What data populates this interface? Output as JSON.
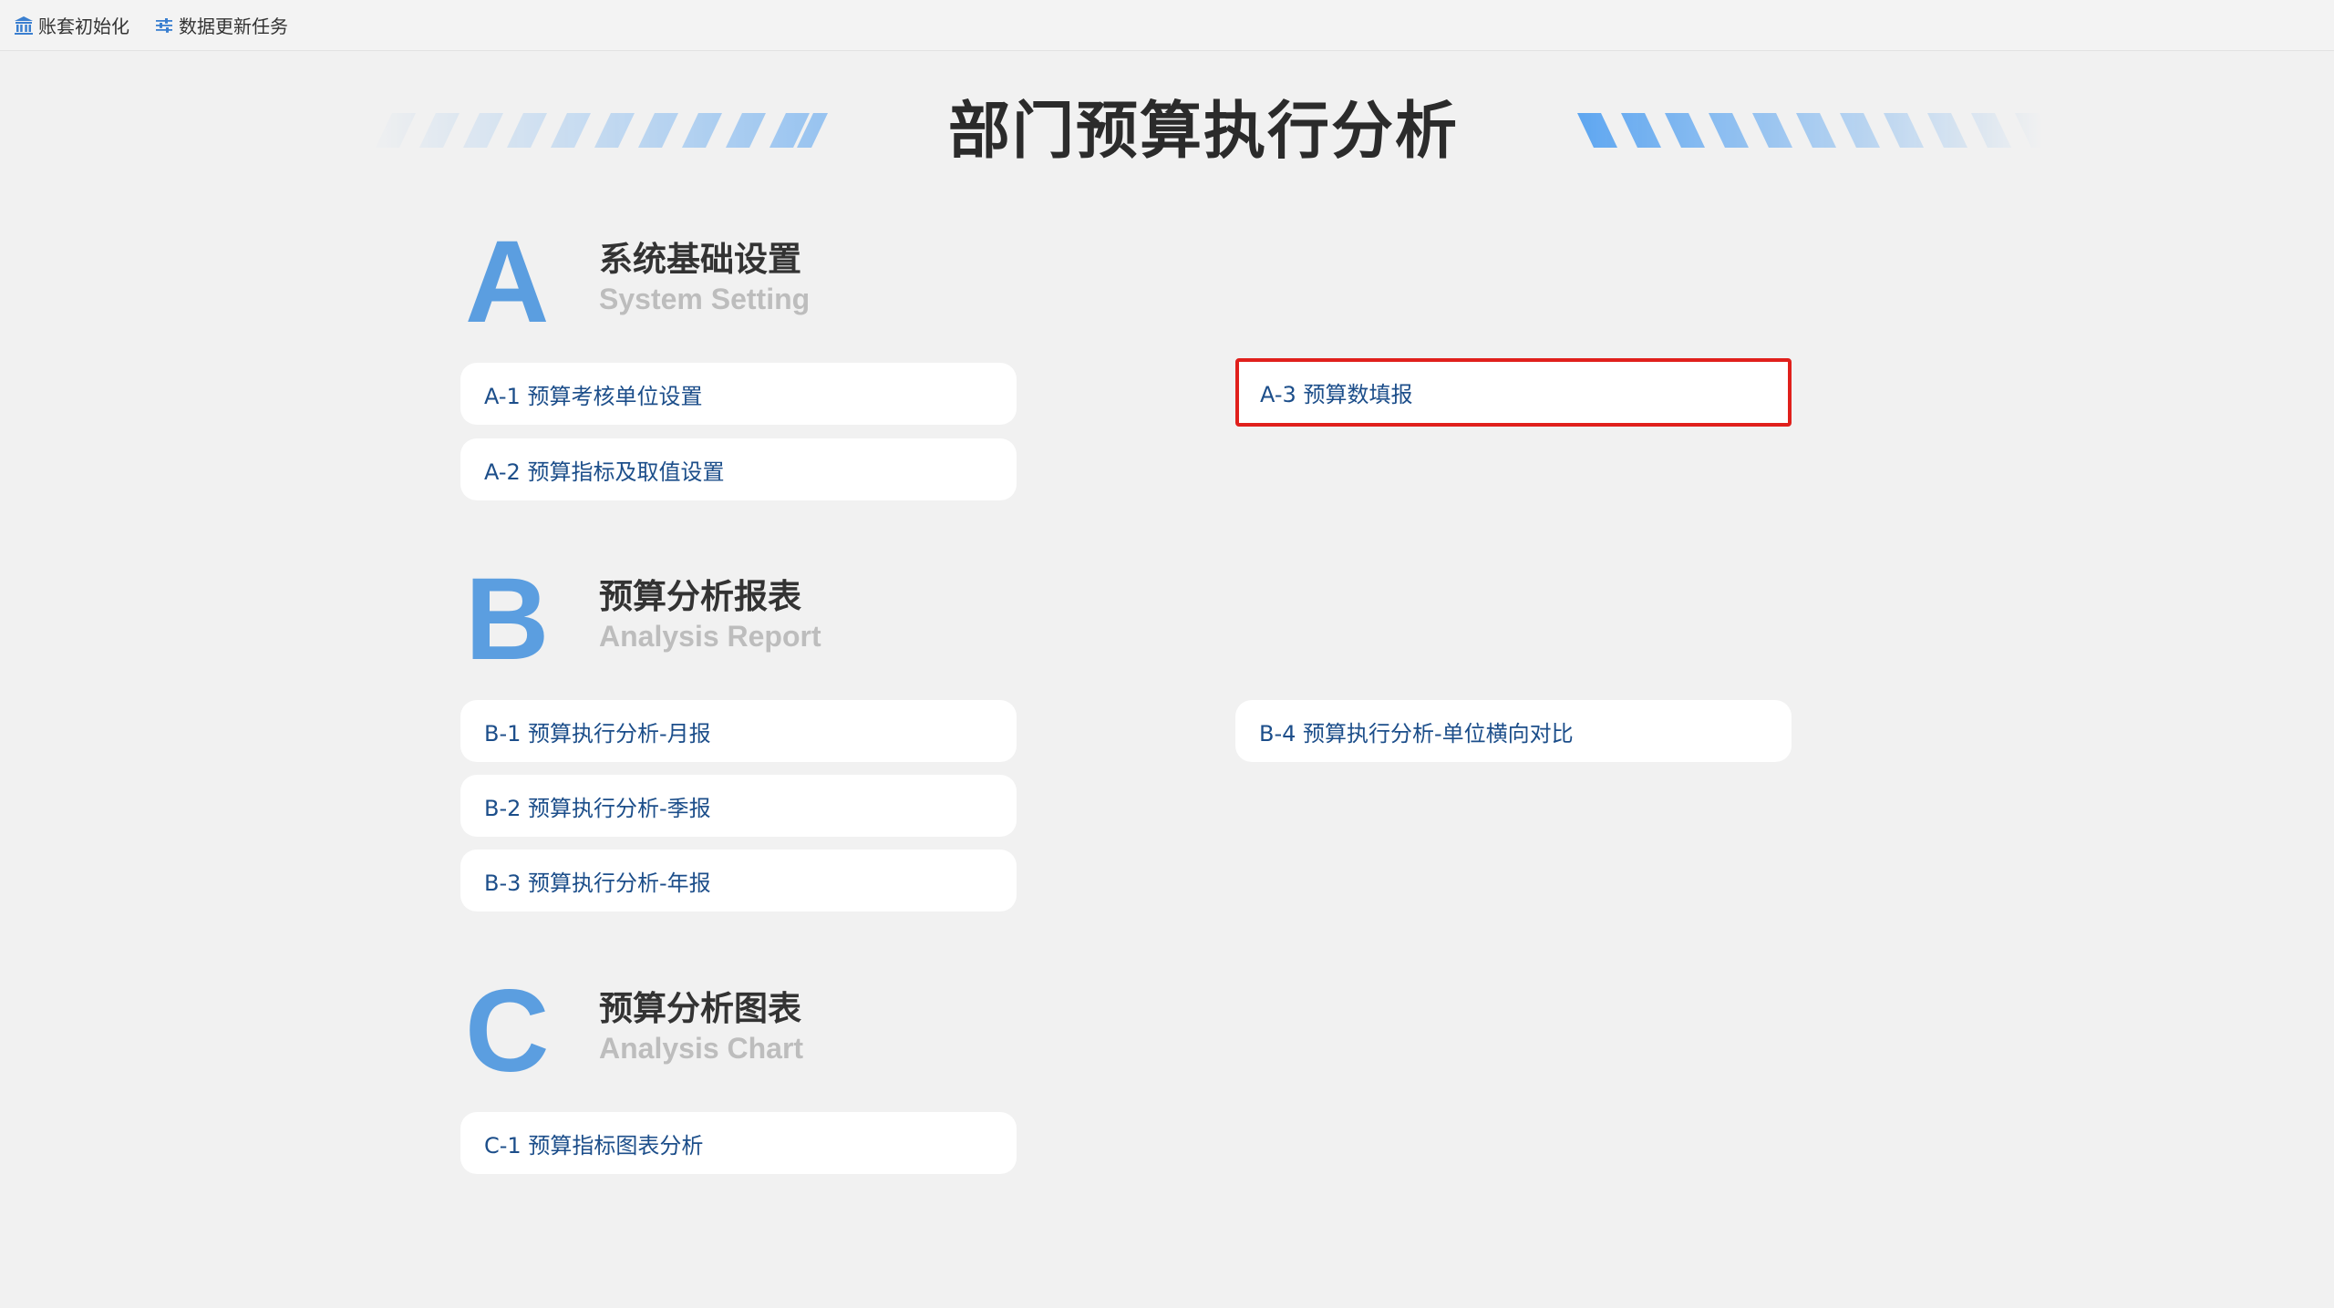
{
  "toolbar": {
    "items": [
      {
        "label": "账套初始化",
        "icon": "bank-icon"
      },
      {
        "label": "数据更新任务",
        "icon": "sliders-icon"
      }
    ]
  },
  "page": {
    "title": "部门预算执行分析"
  },
  "colors": {
    "accent": "#5b9ee0",
    "card_text": "#1c4e8a",
    "selected_border": "#e0201c",
    "background": "#f1f1f1"
  },
  "sections": [
    {
      "letter": "A",
      "title_cn": "系统基础设置",
      "title_en": "System Setting",
      "items": [
        {
          "label": "A-1 预算考核单位设置"
        },
        {
          "label": "A-2 预算指标及取值设置"
        },
        {
          "label": "A-3 预算数填报",
          "selected": true
        }
      ]
    },
    {
      "letter": "B",
      "title_cn": "预算分析报表",
      "title_en": "Analysis Report",
      "items": [
        {
          "label": "B-1 预算执行分析-月报"
        },
        {
          "label": "B-2 预算执行分析-季报"
        },
        {
          "label": "B-3 预算执行分析-年报"
        },
        {
          "label": "B-4 预算执行分析-单位横向对比"
        }
      ]
    },
    {
      "letter": "C",
      "title_cn": "预算分析图表",
      "title_en": "Analysis Chart",
      "items": [
        {
          "label": "C-1 预算指标图表分析"
        }
      ]
    }
  ]
}
